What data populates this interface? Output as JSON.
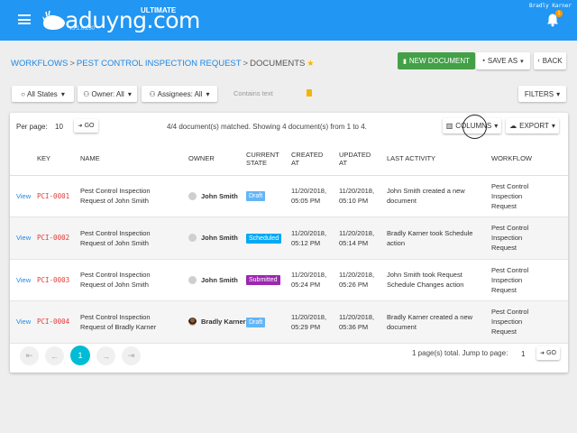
{
  "header": {
    "logo_text": "aduyng.com",
    "logo_tag": "ULTIMATE",
    "version": "v5.1.0.230",
    "username": "Bradly Karner",
    "notification_count": "1",
    "brand_color": "#2196f3"
  },
  "breadcrumb": {
    "items": [
      "WORKFLOWS",
      "PEST CONTROL INSPECTION REQUEST"
    ],
    "current": "DOCUMENTS",
    "separator": ">",
    "star_icon": "★"
  },
  "toolbar": {
    "new_document": "NEW DOCUMENT",
    "save_as": "SAVE AS",
    "back": "BACK"
  },
  "filters": {
    "state": "All States",
    "owner": "Owner: All",
    "assignees": "Assignees: All",
    "search_placeholder": "Contains text",
    "filters_button": "FILTERS"
  },
  "list": {
    "per_page_label": "Per page:",
    "per_page_value": "10",
    "go_label": "GO",
    "matched_text": "4/4 document(s) matched. Showing 4 document(s) from 1 to 4.",
    "columns_button": "COLUMNS",
    "export_button": "EXPORT",
    "headers": {
      "key": "KEY",
      "name": "NAME",
      "owner": "OWNER",
      "state_line1": "CURRENT",
      "state_line2": "STATE",
      "created_line1": "CREATED",
      "created_line2": "AT",
      "updated_line1": "UPDATED",
      "updated_line2": "AT",
      "activity": "LAST ACTIVITY",
      "workflow": "WORKFLOW"
    },
    "rows": [
      {
        "view": "View",
        "key": "PCI-0001",
        "name_l1": "Pest Control Inspection",
        "name_l2": "Request of John Smith",
        "owner": "John Smith",
        "state": "Draft",
        "created_l1": "11/20/2018,",
        "created_l2": "05:05 PM",
        "updated_l1": "11/20/2018,",
        "updated_l2": "05:10 PM",
        "activity_l1": "John Smith created a new",
        "activity_l2": "document",
        "wf_l1": "Pest Control",
        "wf_l2": "Inspection",
        "wf_l3": "Request"
      },
      {
        "view": "View",
        "key": "PCI-0002",
        "name_l1": "Pest Control Inspection",
        "name_l2": "Request of John Smith",
        "owner": "John Smith",
        "state": "Scheduled",
        "created_l1": "11/20/2018,",
        "created_l2": "05:12 PM",
        "updated_l1": "11/20/2018,",
        "updated_l2": "05:14 PM",
        "activity_l1": "Bradly Karner took Schedule",
        "activity_l2": "action",
        "wf_l1": "Pest Control",
        "wf_l2": "Inspection",
        "wf_l3": "Request"
      },
      {
        "view": "View",
        "key": "PCI-0003",
        "name_l1": "Pest Control Inspection",
        "name_l2": "Request of John Smith",
        "owner": "John Smith",
        "state": "Submitted",
        "created_l1": "11/20/2018,",
        "created_l2": "05:24 PM",
        "updated_l1": "11/20/2018,",
        "updated_l2": "05:26 PM",
        "activity_l1": "John Smith took Request",
        "activity_l2": "Schedule Changes action",
        "wf_l1": "Pest Control",
        "wf_l2": "Inspection",
        "wf_l3": "Request"
      },
      {
        "view": "View",
        "key": "PCI-0004",
        "name_l1": "Pest Control Inspection",
        "name_l2": "Request of Bradly Karner",
        "owner": "Bradly Karner",
        "state": "Draft",
        "created_l1": "11/20/2018,",
        "created_l2": "05:29 PM",
        "updated_l1": "11/20/2018,",
        "updated_l2": "05:36 PM",
        "activity_l1": "Bradly Karner created a new",
        "activity_l2": "document",
        "wf_l1": "Pest Control",
        "wf_l2": "Inspection",
        "wf_l3": "Request"
      }
    ],
    "state_colors": {
      "Draft": "#64b5f6",
      "Scheduled": "#03a9f4",
      "Submitted": "#9c27b0"
    }
  },
  "pagination": {
    "first": "⇤",
    "prev": "←",
    "current_page": "1",
    "next": "→",
    "last": "⇥",
    "total_text": "1 page(s) total. Jump to page:",
    "jump_value": "1",
    "go_label": "GO"
  }
}
